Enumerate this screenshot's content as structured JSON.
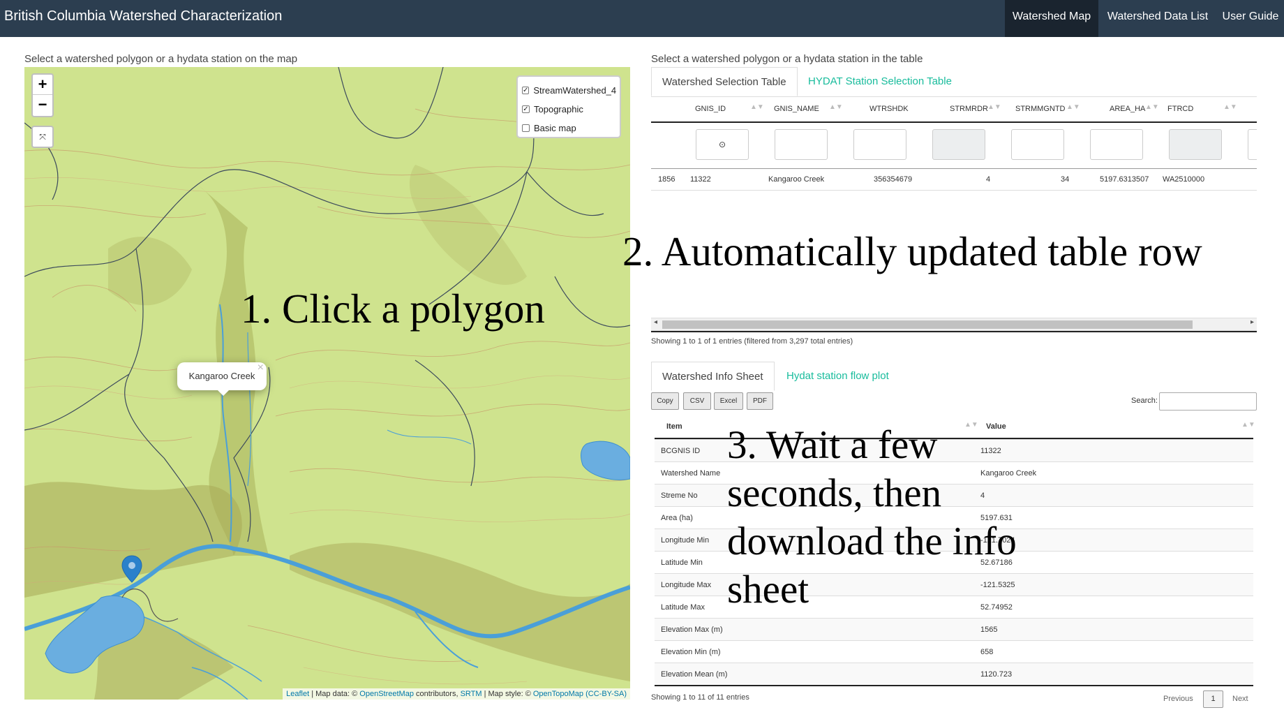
{
  "app": {
    "title": "British Columbia Watershed Characterization"
  },
  "nav": {
    "items": [
      "Watershed Map",
      "Watershed Data List",
      "User Guide"
    ],
    "active": "Watershed Map"
  },
  "map_panel": {
    "label": "Select a watershed polygon or a hydata station on the map",
    "zoom_in": "+",
    "zoom_out": "−",
    "fullscreen_icon": "⤧",
    "layers": [
      {
        "label": "StreamWatershed_4",
        "checked": true,
        "check": "✓"
      },
      {
        "label": "Topographic",
        "checked": true,
        "check": "✓"
      },
      {
        "label": "Basic map",
        "checked": false,
        "check": ""
      }
    ],
    "popup": {
      "text": "Kangaroo Creek",
      "close": "×"
    },
    "attribution": {
      "leaflet": "Leaflet",
      "sep1": " | Map data: © ",
      "osm": "OpenStreetMap",
      "contrib": " contributors, ",
      "srtm": "SRTM",
      "sep2": " | Map style: © ",
      "otm": "OpenTopoMap",
      "license": "(CC-BY-SA)"
    },
    "colors": {
      "land": "#cfe38e",
      "water": "#4a9fd8",
      "marker": "#2a81cb"
    }
  },
  "annotations": {
    "a1": "1. Click a polygon",
    "a2": "2. Automatically updated table row",
    "a3_lines": [
      "3. Wait a few",
      "seconds, then",
      "download the info",
      "sheet"
    ]
  },
  "table_panel": {
    "label": "Select a watershed polygon or a hydata station in the table",
    "tabs": [
      "Watershed Selection Table",
      "HYDAT Station Selection Table"
    ],
    "columns": [
      "GNIS_ID",
      "GNIS_NAME",
      "WTRSHDK",
      "STRMRDR",
      "STRMMGNTD",
      "AREA_HA",
      "FTRCD"
    ],
    "filter_icon": "⊙",
    "row": {
      "index": "1856",
      "GNIS_ID": "11322",
      "GNIS_NAME": "Kangaroo Creek",
      "WTRSHDK": "356354679",
      "STRMRDR": "4",
      "STRMMGNTD": "34",
      "AREA_HA": "5197.6313507",
      "FTRCD": "WA2510000"
    },
    "info": "Showing 1 to 1 of 1 entries (filtered from 3,297 total entries)",
    "scroll_left": "◂",
    "scroll_right": "▸"
  },
  "info_panel": {
    "tabs": [
      "Watershed Info Sheet",
      "Hydat station flow plot"
    ],
    "buttons": [
      "Copy",
      "CSV",
      "Excel",
      "PDF"
    ],
    "search_label": "Search:",
    "headers": [
      "Item",
      "Value"
    ],
    "rows": [
      {
        "item": "BCGNIS ID",
        "value": "11322"
      },
      {
        "item": "Watershed Name",
        "value": "Kangaroo Creek"
      },
      {
        "item": "Streme No",
        "value": "4"
      },
      {
        "item": "Area (ha)",
        "value": "5197.631"
      },
      {
        "item": "Longitude Min",
        "value": "-121.7024"
      },
      {
        "item": "Latitude Min",
        "value": "52.67186"
      },
      {
        "item": "Longitude Max",
        "value": "-121.5325"
      },
      {
        "item": "Latitude Max",
        "value": "52.74952"
      },
      {
        "item": "Elevation Max (m)",
        "value": "1565"
      },
      {
        "item": "Elevation Min (m)",
        "value": "658"
      },
      {
        "item": "Elevation Mean (m)",
        "value": "1120.723"
      }
    ],
    "info": "Showing 1 to 11 of 11 entries",
    "pagination": {
      "previous": "Previous",
      "current": "1",
      "next": "Next"
    },
    "sort_icon": "▲▼"
  }
}
